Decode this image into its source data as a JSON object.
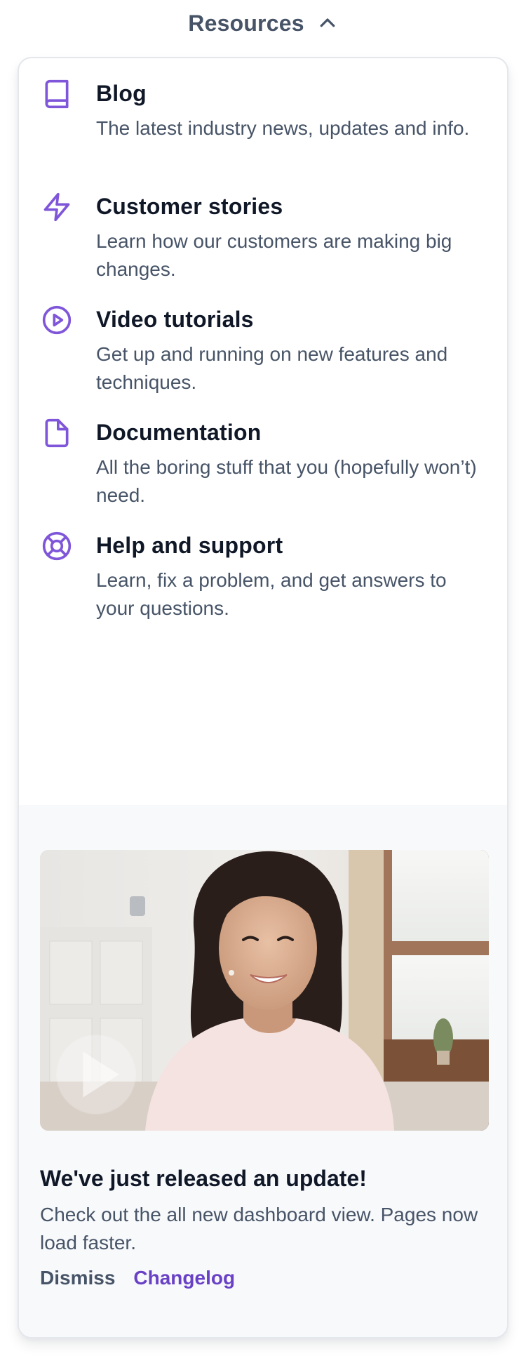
{
  "trigger": {
    "label": "Resources"
  },
  "menu": {
    "items": [
      {
        "icon": "book-icon",
        "title": "Blog",
        "description": "The latest industry news, updates and info."
      },
      {
        "icon": "lightning-icon",
        "title": "Customer stories",
        "description": "Learn how our customers are making big changes."
      },
      {
        "icon": "play-circle-icon",
        "title": "Video tutorials",
        "description": "Get up and running on new features and techniques."
      },
      {
        "icon": "file-icon",
        "title": "Documentation",
        "description": "All the boring stuff that you (hopefully won’t) need."
      },
      {
        "icon": "life-buoy-icon",
        "title": "Help and support",
        "description": "Learn, fix a problem, and get answers to your questions."
      }
    ]
  },
  "featured": {
    "image": "woman-smiling-photo",
    "title": "We've just released an update!",
    "description": "Check out the all new dashboard view. Pages now load faster.",
    "dismiss_label": "Dismiss",
    "changelog_label": "Changelog"
  },
  "colors": {
    "accent": "#7f56d9",
    "link": "#6941c6",
    "text_primary": "#101828",
    "text_secondary": "#475467",
    "featured_bg": "#f8f9fb",
    "border": "#e4e7ec"
  }
}
